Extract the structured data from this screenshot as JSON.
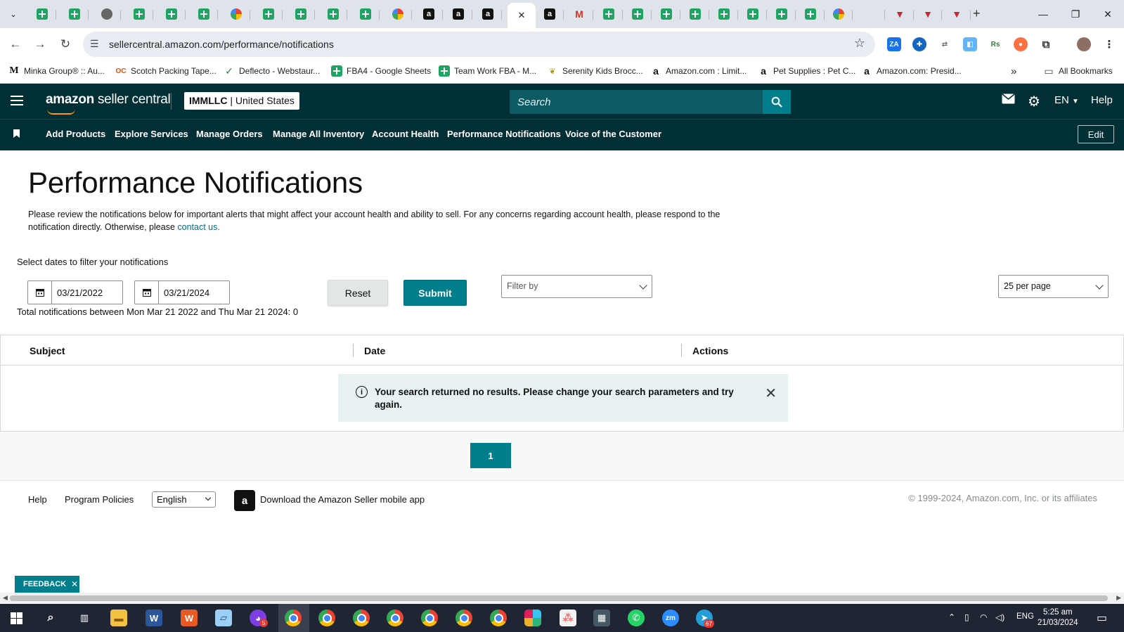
{
  "browser": {
    "address": "sellercentral.amazon.com/performance/notifications",
    "tabs": [
      {
        "icon": "sheets"
      },
      {
        "icon": "sheets"
      },
      {
        "icon": "globe"
      },
      {
        "icon": "sheets"
      },
      {
        "icon": "sheets"
      },
      {
        "icon": "sheets"
      },
      {
        "icon": "multi"
      },
      {
        "icon": "sheets"
      },
      {
        "icon": "sheets"
      },
      {
        "icon": "sheets"
      },
      {
        "icon": "sheets"
      },
      {
        "icon": "multi"
      },
      {
        "icon": "amazon"
      },
      {
        "icon": "amazon"
      },
      {
        "icon": "amazon"
      },
      {
        "icon": "active-close"
      },
      {
        "icon": "amazon"
      },
      {
        "icon": "gmail"
      },
      {
        "icon": "sheets"
      },
      {
        "icon": "sheets"
      },
      {
        "icon": "sheets"
      },
      {
        "icon": "sheets"
      },
      {
        "icon": "sheets"
      },
      {
        "icon": "sheets"
      },
      {
        "icon": "sheets"
      },
      {
        "icon": "sheets"
      },
      {
        "icon": "multi"
      },
      {
        "icon": "blank"
      },
      {
        "icon": "red"
      },
      {
        "icon": "red"
      },
      {
        "icon": "red"
      }
    ],
    "bookmarks": [
      {
        "label": "Minka Group® :: Au...",
        "icon": "M"
      },
      {
        "label": "Scotch Packing Tape...",
        "icon": "OC"
      },
      {
        "label": "Deflecto - Webstaur...",
        "icon": "D"
      },
      {
        "label": "FBA4 - Google Sheets",
        "icon": "sheets"
      },
      {
        "label": "Team Work FBA - M...",
        "icon": "sheets"
      },
      {
        "label": "Serenity Kids Brocc...",
        "icon": "leaf"
      },
      {
        "label": "Amazon.com : Limit...",
        "icon": "a"
      },
      {
        "label": "Pet Supplies : Pet C...",
        "icon": "a"
      },
      {
        "label": "Amazon.com: Presid...",
        "icon": "a"
      }
    ],
    "all_bookmarks": "All Bookmarks",
    "more": "»"
  },
  "header": {
    "logo_brand": "amazon",
    "logo_product": "seller central",
    "account_name": "IMMLLC",
    "account_sep": "|",
    "marketplace": "United States",
    "search_placeholder": "Search",
    "language": "EN",
    "help": "Help"
  },
  "nav": {
    "items": [
      "Add Products",
      "Explore Services",
      "Manage Orders",
      "Manage All Inventory",
      "Account Health",
      "Performance Notifications",
      "Voice of the Customer"
    ],
    "edit": "Edit"
  },
  "page": {
    "title": "Performance Notifications",
    "description": "Please review the notifications below for important alerts that might affect your account health and ability to sell. For any concerns regarding account health, please respond to the notification directly. Otherwise, please",
    "contact_link": "contact us.",
    "filter_label": "Select dates to filter your notifications",
    "start_date": "03/21/2022",
    "end_date": "03/21/2024",
    "reset": "Reset",
    "submit": "Submit",
    "filter_by": "Filter by",
    "per_page": "25 per page",
    "total": "Total notifications between Mon Mar 21 2022 and Thu Mar 21 2024: 0"
  },
  "table": {
    "columns": [
      "Subject",
      "Date",
      "Actions"
    ],
    "empty_message": "Your search returned no results. Please change your search parameters and try again."
  },
  "pager": {
    "current": "1"
  },
  "footer": {
    "help": "Help",
    "policies": "Program Policies",
    "language": "English",
    "app_text": "Download the Amazon Seller mobile app",
    "copyright": "© 1999-2024, Amazon.com, Inc. or its affiliates"
  },
  "feedback": "FEEDBACK",
  "taskbar": {
    "lang": "ENG",
    "time": "5:25 am",
    "date": "21/03/2024",
    "badges": {
      "app1": "5",
      "telegram": "67"
    }
  },
  "colors": {
    "header_bg": "#002f36",
    "teal": "#017e8c",
    "alert_bg": "#e8f2f2"
  }
}
